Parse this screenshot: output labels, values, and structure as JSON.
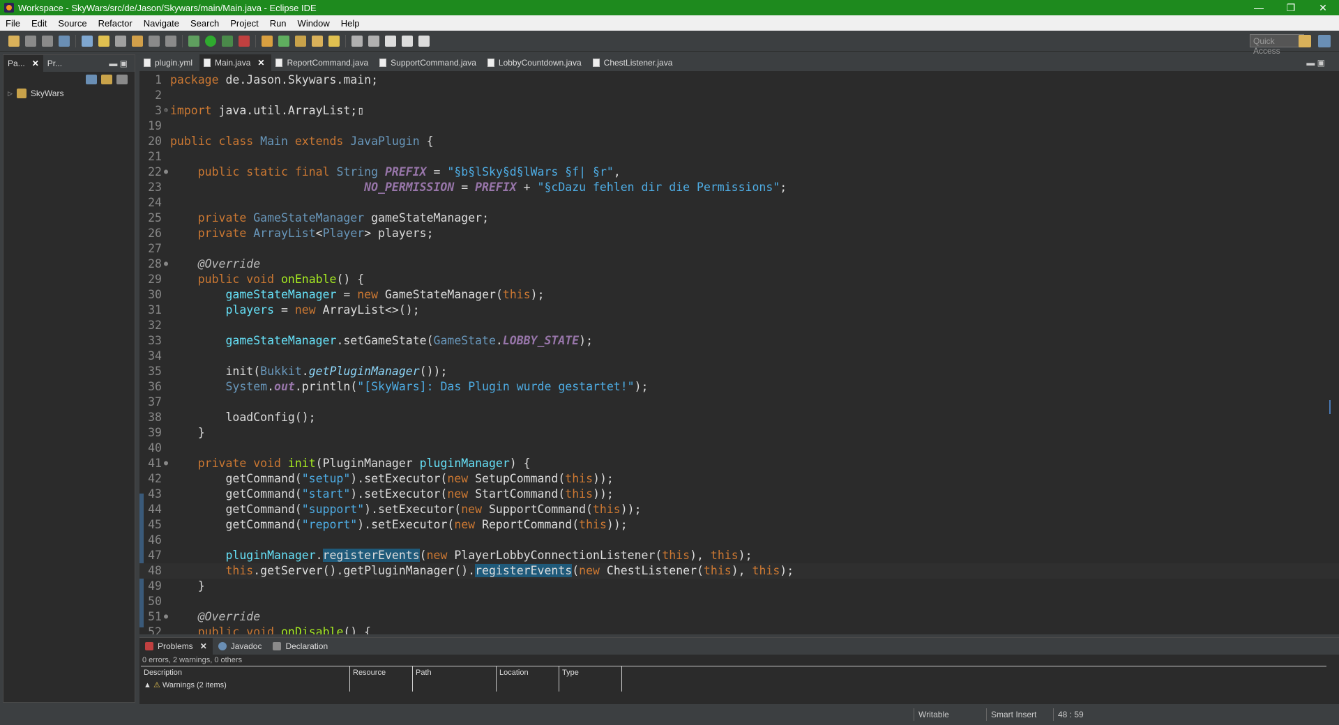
{
  "window": {
    "title": "Workspace - SkyWars/src/de/Jason/Skywars/main/Main.java - Eclipse IDE",
    "min": "—",
    "max": "❐",
    "close": "✕"
  },
  "menu": [
    "File",
    "Edit",
    "Source",
    "Refactor",
    "Navigate",
    "Search",
    "Project",
    "Run",
    "Window",
    "Help"
  ],
  "quick_access": "Quick Access",
  "left": {
    "tabs": [
      {
        "label": "Pa...",
        "active": true,
        "close": "✕"
      },
      {
        "label": "Pr...",
        "active": false
      }
    ],
    "tree": [
      {
        "label": "SkyWars",
        "expander": "▷"
      }
    ]
  },
  "editor": {
    "tabs": [
      {
        "label": "plugin.yml",
        "active": false
      },
      {
        "label": "Main.java",
        "active": true,
        "close": "✕"
      },
      {
        "label": "ReportCommand.java",
        "active": false
      },
      {
        "label": "SupportCommand.java",
        "active": false
      },
      {
        "label": "LobbyCountdown.java",
        "active": false
      },
      {
        "label": "ChestListener.java",
        "active": false
      }
    ],
    "lines": [
      {
        "n": "1",
        "m": "",
        "t": [
          [
            "kw",
            "package "
          ],
          [
            "def",
            "de.Jason.Skywars.main;"
          ]
        ]
      },
      {
        "n": "2",
        "m": "",
        "t": []
      },
      {
        "n": "3",
        "m": "⊕",
        "t": [
          [
            "kw",
            "import "
          ],
          [
            "def",
            "java.util.ArrayList;"
          ],
          [
            "def",
            "▯"
          ]
        ]
      },
      {
        "n": "19",
        "m": "",
        "t": []
      },
      {
        "n": "20",
        "m": "",
        "t": [
          [
            "kw",
            "public class "
          ],
          [
            "cls",
            "Main "
          ],
          [
            "kw",
            "extends "
          ],
          [
            "cls",
            "JavaPlugin "
          ],
          [
            "def",
            "{"
          ]
        ]
      },
      {
        "n": "21",
        "m": "",
        "t": []
      },
      {
        "n": "22",
        "m": "●",
        "t": [
          [
            "def",
            "    "
          ],
          [
            "kw",
            "public static final "
          ],
          [
            "cls",
            "String "
          ],
          [
            "cst",
            "PREFIX"
          ],
          [
            "def",
            " = "
          ],
          [
            "str",
            "\"§b§lSky§d§lWars §f| §r\""
          ],
          [
            "def",
            ","
          ]
        ]
      },
      {
        "n": "23",
        "m": "",
        "t": [
          [
            "def",
            "                            "
          ],
          [
            "cst",
            "NO_PERMISSION"
          ],
          [
            "def",
            " = "
          ],
          [
            "cst",
            "PREFIX"
          ],
          [
            "def",
            " + "
          ],
          [
            "str",
            "\"§cDazu fehlen dir die Permissions\""
          ],
          [
            "def",
            ";"
          ]
        ]
      },
      {
        "n": "24",
        "m": "",
        "t": []
      },
      {
        "n": "25",
        "m": "",
        "t": [
          [
            "def",
            "    "
          ],
          [
            "kw",
            "private "
          ],
          [
            "cls",
            "GameStateManager "
          ],
          [
            "def",
            "gameStateManager;"
          ]
        ]
      },
      {
        "n": "26",
        "m": "",
        "t": [
          [
            "def",
            "    "
          ],
          [
            "kw",
            "private "
          ],
          [
            "cls",
            "ArrayList"
          ],
          [
            "def",
            "<"
          ],
          [
            "cls",
            "Player"
          ],
          [
            "def",
            "> players;"
          ]
        ]
      },
      {
        "n": "27",
        "m": "",
        "t": []
      },
      {
        "n": "28",
        "m": "●",
        "t": [
          [
            "def",
            "    "
          ],
          [
            "ann",
            "@Override"
          ]
        ]
      },
      {
        "n": "29",
        "m": "",
        "t": [
          [
            "def",
            "    "
          ],
          [
            "kw",
            "public void "
          ],
          [
            "mth",
            "onEnable"
          ],
          [
            "def",
            "() {"
          ]
        ]
      },
      {
        "n": "30",
        "m": "",
        "t": [
          [
            "def",
            "        "
          ],
          [
            "fld",
            "gameStateManager"
          ],
          [
            "def",
            " = "
          ],
          [
            "kw",
            "new "
          ],
          [
            "def",
            "GameStateManager("
          ],
          [
            "kw",
            "this"
          ],
          [
            "def",
            ");"
          ]
        ]
      },
      {
        "n": "31",
        "m": "",
        "t": [
          [
            "def",
            "        "
          ],
          [
            "fld",
            "players"
          ],
          [
            "def",
            " = "
          ],
          [
            "kw",
            "new "
          ],
          [
            "def",
            "ArrayList<>();"
          ]
        ]
      },
      {
        "n": "32",
        "m": "",
        "t": []
      },
      {
        "n": "33",
        "m": "",
        "t": [
          [
            "def",
            "        "
          ],
          [
            "fld",
            "gameStateManager"
          ],
          [
            "def",
            ".setGameState("
          ],
          [
            "cls",
            "GameState"
          ],
          [
            "def",
            "."
          ],
          [
            "cst",
            "LOBBY_STATE"
          ],
          [
            "def",
            ");"
          ]
        ]
      },
      {
        "n": "34",
        "m": "",
        "t": []
      },
      {
        "n": "35",
        "m": "",
        "t": [
          [
            "def",
            "        init("
          ],
          [
            "cls",
            "Bukkit"
          ],
          [
            "def",
            "."
          ],
          [
            "sfld",
            "getPluginManager"
          ],
          [
            "def",
            "());"
          ]
        ]
      },
      {
        "n": "36",
        "m": "",
        "t": [
          [
            "def",
            "        "
          ],
          [
            "cls",
            "System"
          ],
          [
            "def",
            "."
          ],
          [
            "cst",
            "out"
          ],
          [
            "def",
            ".println("
          ],
          [
            "str",
            "\"[SkyWars]: Das Plugin wurde gestartet!\""
          ],
          [
            "def",
            ");"
          ]
        ]
      },
      {
        "n": "37",
        "m": "",
        "t": []
      },
      {
        "n": "38",
        "m": "",
        "t": [
          [
            "def",
            "        loadConfig();"
          ]
        ]
      },
      {
        "n": "39",
        "m": "",
        "t": [
          [
            "def",
            "    }"
          ]
        ]
      },
      {
        "n": "40",
        "m": "",
        "t": []
      },
      {
        "n": "41",
        "m": "●",
        "t": [
          [
            "def",
            "    "
          ],
          [
            "kw",
            "private void "
          ],
          [
            "mth",
            "init"
          ],
          [
            "def",
            "(PluginManager "
          ],
          [
            "fld",
            "pluginManager"
          ],
          [
            "def",
            ") {"
          ]
        ]
      },
      {
        "n": "42",
        "m": "",
        "t": [
          [
            "def",
            "        getCommand("
          ],
          [
            "str",
            "\"setup\""
          ],
          [
            "def",
            ").setExecutor("
          ],
          [
            "kw",
            "new "
          ],
          [
            "def",
            "SetupCommand("
          ],
          [
            "kw",
            "this"
          ],
          [
            "def",
            "));"
          ]
        ]
      },
      {
        "n": "43",
        "m": "",
        "t": [
          [
            "def",
            "        getCommand("
          ],
          [
            "str",
            "\"start\""
          ],
          [
            "def",
            ").setExecutor("
          ],
          [
            "kw",
            "new "
          ],
          [
            "def",
            "StartCommand("
          ],
          [
            "kw",
            "this"
          ],
          [
            "def",
            "));"
          ]
        ]
      },
      {
        "n": "44",
        "m": "",
        "t": [
          [
            "def",
            "        getCommand("
          ],
          [
            "str",
            "\"support\""
          ],
          [
            "def",
            ").setExecutor("
          ],
          [
            "kw",
            "new "
          ],
          [
            "def",
            "SupportCommand("
          ],
          [
            "kw",
            "this"
          ],
          [
            "def",
            "));"
          ]
        ]
      },
      {
        "n": "45",
        "m": "",
        "t": [
          [
            "def",
            "        getCommand("
          ],
          [
            "str",
            "\"report\""
          ],
          [
            "def",
            ").setExecutor("
          ],
          [
            "kw",
            "new "
          ],
          [
            "def",
            "ReportCommand("
          ],
          [
            "kw",
            "this"
          ],
          [
            "def",
            "));"
          ]
        ]
      },
      {
        "n": "46",
        "m": "",
        "t": []
      },
      {
        "n": "47",
        "m": "",
        "t": [
          [
            "def",
            "        "
          ],
          [
            "fld",
            "pluginManager"
          ],
          [
            "def",
            "."
          ],
          [
            "hl",
            "registerEvents"
          ],
          [
            "def",
            "("
          ],
          [
            "kw",
            "new "
          ],
          [
            "def",
            "PlayerLobbyConnectionListener("
          ],
          [
            "kw",
            "this"
          ],
          [
            "def",
            "), "
          ],
          [
            "kw",
            "this"
          ],
          [
            "def",
            ");"
          ]
        ]
      },
      {
        "n": "48",
        "m": "",
        "t": [
          [
            "def",
            "        "
          ],
          [
            "kw",
            "this"
          ],
          [
            "def",
            ".getServer().getPluginManager()."
          ],
          [
            "hl",
            "registerEvents"
          ],
          [
            "def",
            "("
          ],
          [
            "kw",
            "new "
          ],
          [
            "def",
            "ChestListener("
          ],
          [
            "kw",
            "this"
          ],
          [
            "def",
            "), "
          ],
          [
            "kw",
            "this"
          ],
          [
            "def",
            ");"
          ]
        ],
        "current": true
      },
      {
        "n": "49",
        "m": "",
        "t": [
          [
            "def",
            "    }"
          ]
        ]
      },
      {
        "n": "50",
        "m": "",
        "t": []
      },
      {
        "n": "51",
        "m": "●",
        "t": [
          [
            "def",
            "    "
          ],
          [
            "ann",
            "@Override"
          ]
        ]
      },
      {
        "n": "52",
        "m": "",
        "t": [
          [
            "def",
            "    "
          ],
          [
            "kw",
            "public void "
          ],
          [
            "mth",
            "onDisable"
          ],
          [
            "def",
            "() {"
          ]
        ]
      }
    ]
  },
  "bottom": {
    "tabs": [
      {
        "label": "Problems",
        "active": true,
        "close": "✕"
      },
      {
        "label": "Javadoc"
      },
      {
        "label": "Declaration"
      }
    ],
    "summary": "0 errors, 2 warnings, 0 others",
    "columns": [
      "Description",
      "Resource",
      "Path",
      "Location",
      "Type"
    ],
    "rows": [
      {
        "expander": "▲",
        "desc": "Warnings (2 items)"
      }
    ]
  },
  "status": {
    "writable": "Writable",
    "insert": "Smart Insert",
    "pos": "48 : 59"
  },
  "colors": {
    "titlebar": "#1e8a1e",
    "editor_bg": "#2b2b2b",
    "chrome": "#3c3f41"
  }
}
